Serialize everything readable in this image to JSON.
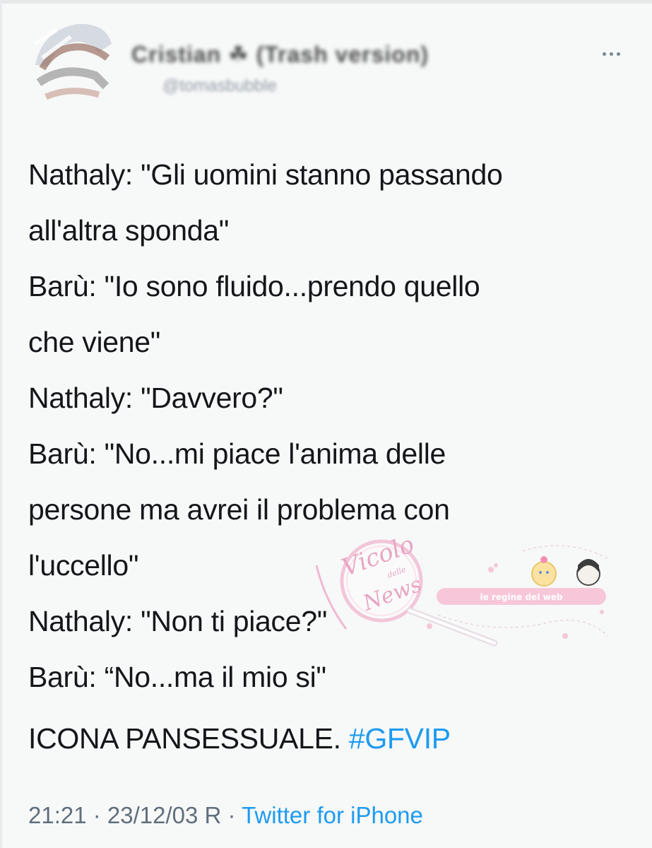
{
  "tweet": {
    "display_name": "Cristian ☘ (Trash version)",
    "handle": "@tomasbubble",
    "lines": [
      "Nathaly: \"Gli uomini stanno passando",
      "all'altra sponda\"",
      "Barù: \"Io sono fluido...prendo quello",
      "che viene\"",
      "Nathaly: \"Davvero?\"",
      "Barù: \"No...mi piace l'anima delle",
      "persone ma avrei il problema con",
      "l'uccello\"",
      "Nathaly: \"Non ti piace?\"",
      "Barù: “No...ma il mio si\""
    ],
    "final_text": "ICONA PANSESSUALE. ",
    "hashtag": "#GFVIP",
    "timestamp": "21:21 · 23/12/03 R · ",
    "source": "Twitter for iPhone",
    "more_icon": "more-horizontal-icon"
  },
  "watermark": {
    "left_text": "Vicolo",
    "left_small": "delle",
    "left_text2": "News",
    "right_text": "le regine del web"
  },
  "colors": {
    "hashtag": "#1d9bf0",
    "meta": "#5f6f7d",
    "text": "#141619",
    "background": "#f7f8f8"
  }
}
